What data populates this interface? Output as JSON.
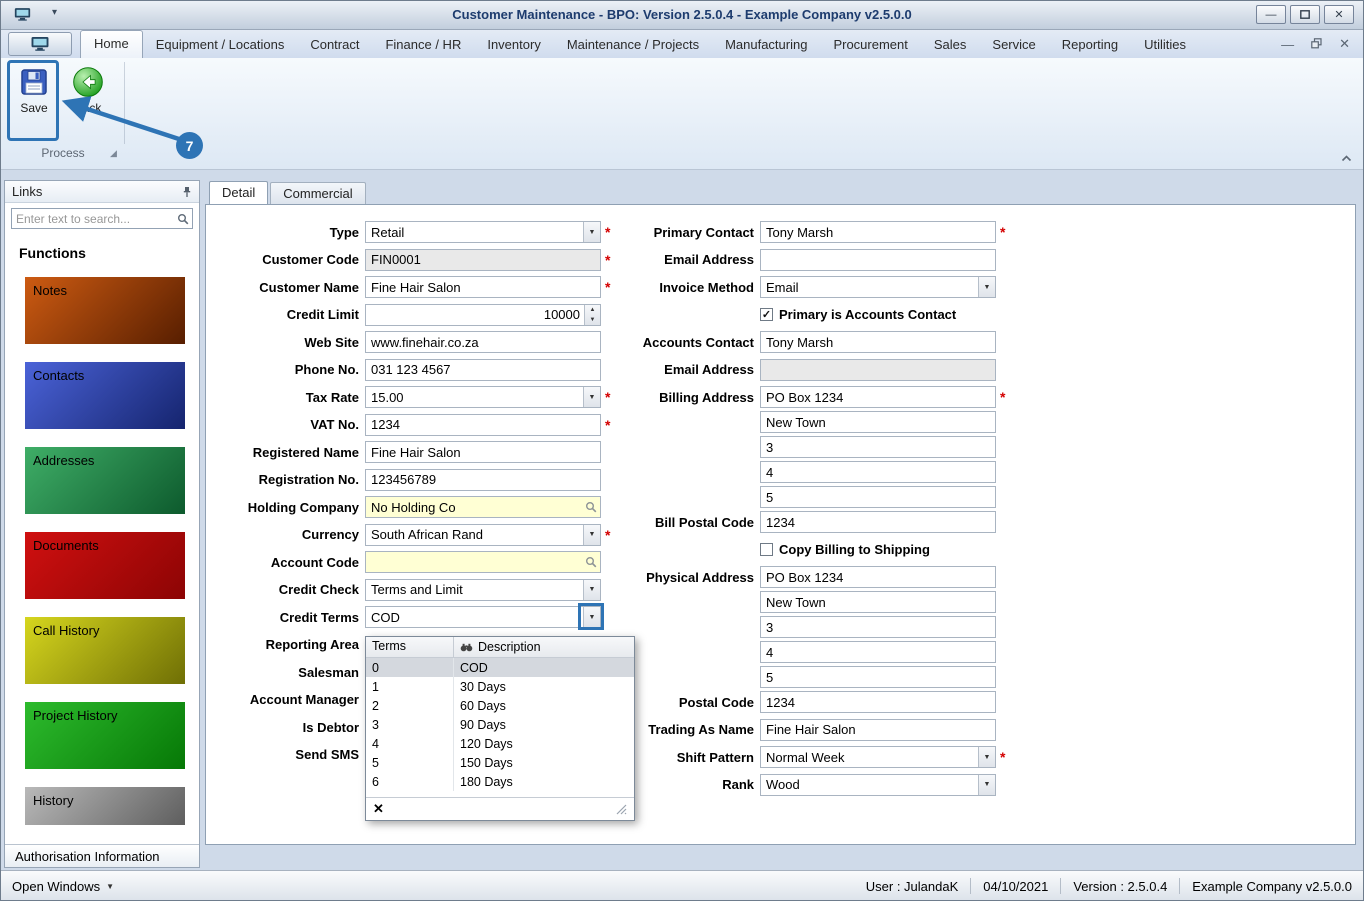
{
  "window": {
    "title": "Customer Maintenance - BPO: Version 2.5.0.4 - Example Company v2.5.0.0"
  },
  "icons": {
    "minimize": "—",
    "close": "✕",
    "qat_arrow": "▾",
    "chevron_down": "▼",
    "spin_up": "▲",
    "spin_down": "▼",
    "check": "✓",
    "clear": "✕",
    "open_windows_arrow": "▼",
    "launcher": "◢"
  },
  "annotations": {
    "badge": "7",
    "accent": "#2e74b5"
  },
  "ribbon": {
    "tabs": [
      {
        "label": "Home",
        "active": true
      },
      {
        "label": "Equipment / Locations"
      },
      {
        "label": "Contract"
      },
      {
        "label": "Finance / HR"
      },
      {
        "label": "Inventory"
      },
      {
        "label": "Maintenance / Projects"
      },
      {
        "label": "Manufacturing"
      },
      {
        "label": "Procurement"
      },
      {
        "label": "Sales"
      },
      {
        "label": "Service"
      },
      {
        "label": "Reporting"
      },
      {
        "label": "Utilities"
      }
    ],
    "buttons": [
      {
        "label": "Save"
      },
      {
        "label": "Back"
      }
    ],
    "group_label": "Process"
  },
  "sidebar": {
    "header": "Links",
    "search_placeholder": "Enter text to search...",
    "section_title": "Functions",
    "functions": [
      {
        "label": "Notes",
        "color_start": "#cd5b12",
        "color_end": "#571e00"
      },
      {
        "label": "Contacts",
        "color_start": "#4b63d8",
        "color_end": "#15246e"
      },
      {
        "label": "Addresses",
        "color_start": "#3fae67",
        "color_end": "#0d5a2d"
      },
      {
        "label": "Documents",
        "color_start": "#d01010",
        "color_end": "#8c0404"
      },
      {
        "label": "Call History",
        "color_start": "#d6d61e",
        "color_end": "#6f6f05"
      },
      {
        "label": "Project History",
        "color_start": "#2dbb2d",
        "color_end": "#067806"
      },
      {
        "label": "History",
        "color_start": "#b9b9b9",
        "color_end": "#5e5e5e"
      }
    ],
    "footer_tab": "Authorisation Information"
  },
  "main": {
    "tabs": [
      {
        "label": "Detail",
        "active": true
      },
      {
        "label": "Commercial"
      }
    ],
    "left_fields": [
      {
        "label": "Type",
        "value": "Retail",
        "type": "dropdown",
        "required": true
      },
      {
        "label": "Customer Code",
        "value": "FIN0001",
        "type": "text",
        "disabled": true,
        "required": true
      },
      {
        "label": "Customer Name",
        "value": "Fine Hair Salon",
        "type": "text",
        "required": true
      },
      {
        "label": "Credit Limit",
        "value": "10000",
        "type": "spin"
      },
      {
        "label": "Web Site",
        "value": "www.finehair.co.za",
        "type": "text"
      },
      {
        "label": "Phone No.",
        "value": "031 123 4567",
        "type": "text"
      },
      {
        "label": "Tax Rate",
        "value": "15.00",
        "type": "dropdown",
        "required": true
      },
      {
        "label": "VAT No.",
        "value": "1234",
        "type": "text",
        "required": true
      },
      {
        "label": "Registered Name",
        "value": "Fine Hair Salon",
        "type": "text"
      },
      {
        "label": "Registration No.",
        "value": "123456789",
        "type": "text"
      },
      {
        "label": "Holding Company",
        "value": "No Holding Co",
        "type": "lookup"
      },
      {
        "label": "Currency",
        "value": "South African Rand",
        "type": "dropdown",
        "required": true
      },
      {
        "label": "Account Code",
        "value": "",
        "type": "lookup"
      },
      {
        "label": "Credit Check",
        "value": "Terms and Limit",
        "type": "dropdown"
      },
      {
        "label": "Credit Terms",
        "value": "COD",
        "type": "dropdown"
      },
      {
        "label": "Reporting Area",
        "type": "labelonly"
      },
      {
        "label": "Salesman",
        "type": "labelonly"
      },
      {
        "label": "Account Manager",
        "type": "labelonly"
      },
      {
        "label": "Is Debtor",
        "type": "labelonly"
      },
      {
        "label": "Send SMS",
        "type": "labelonly"
      }
    ],
    "right_fields": [
      {
        "label": "Primary Contact",
        "value": "Tony Marsh",
        "type": "text",
        "required": true
      },
      {
        "label": "Email Address",
        "value": "",
        "type": "text"
      },
      {
        "label": "Invoice Method",
        "value": "Email",
        "type": "dropdown"
      },
      {
        "label": "Primary is Accounts Contact",
        "type": "checkbox",
        "checked": true
      },
      {
        "label": "Accounts Contact",
        "value": "Tony Marsh",
        "type": "text"
      },
      {
        "label": "Email Address",
        "value": "",
        "type": "text",
        "disabled": true
      },
      {
        "label": "Billing Address",
        "value": "PO Box 1234",
        "type": "text",
        "required": true,
        "tight": true
      },
      {
        "label": "",
        "value": "New Town",
        "type": "text",
        "tight": true
      },
      {
        "label": "",
        "value": "3",
        "type": "text",
        "tight": true
      },
      {
        "label": "",
        "value": "4",
        "type": "text",
        "tight": true
      },
      {
        "label": "",
        "value": "5",
        "type": "text",
        "tight": true
      },
      {
        "label": "Bill Postal Code",
        "value": "1234",
        "type": "text"
      },
      {
        "label": "Copy Billing to Shipping",
        "type": "checkbox",
        "checked": false
      },
      {
        "label": "Physical Address",
        "value": "PO Box 1234",
        "type": "text",
        "tight": true
      },
      {
        "label": "",
        "value": "New Town",
        "type": "text",
        "tight": true
      },
      {
        "label": "",
        "value": "3",
        "type": "text",
        "tight": true
      },
      {
        "label": "",
        "value": "4",
        "type": "text",
        "tight": true
      },
      {
        "label": "",
        "value": "5",
        "type": "text",
        "tight": true
      },
      {
        "label": "Postal Code",
        "value": "1234",
        "type": "text"
      },
      {
        "label": "Trading As Name",
        "value": "Fine Hair Salon",
        "type": "text"
      },
      {
        "label": "Shift Pattern",
        "value": "Normal Week",
        "type": "dropdown",
        "required": true
      },
      {
        "label": "Rank",
        "value": "Wood",
        "type": "dropdown"
      }
    ],
    "terms_dropdown": {
      "columns": [
        "Terms",
        "Description"
      ],
      "rows": [
        {
          "terms": "0",
          "description": "COD",
          "selected": true
        },
        {
          "terms": "1",
          "description": "30 Days"
        },
        {
          "terms": "2",
          "description": "60 Days"
        },
        {
          "terms": "3",
          "description": "90 Days"
        },
        {
          "terms": "4",
          "description": "120 Days"
        },
        {
          "terms": "5",
          "description": "150 Days"
        },
        {
          "terms": "6",
          "description": "180 Days"
        }
      ]
    }
  },
  "statusbar": {
    "open_windows": "Open Windows",
    "items": [
      "User : JulandaK",
      "04/10/2021",
      "Version : 2.5.0.4",
      "Example Company v2.5.0.0"
    ]
  }
}
